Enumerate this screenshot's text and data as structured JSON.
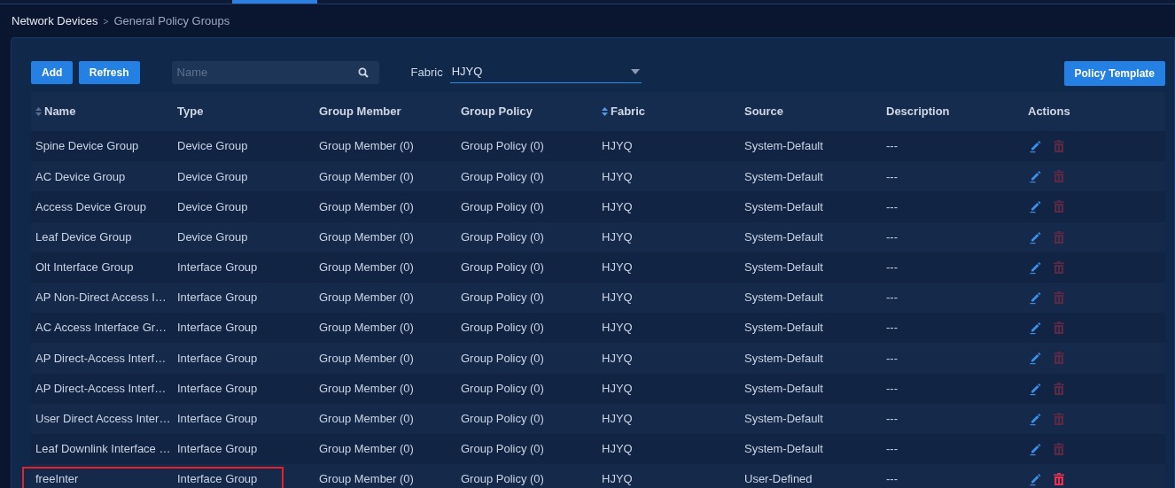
{
  "breadcrumb": [
    "Network Devices",
    ">",
    "General Policy Groups"
  ],
  "toolbar": {
    "buttons": [
      "Add",
      "Refresh"
    ],
    "search": {
      "placeholder": "Name"
    },
    "fabric_label": "Fabric",
    "fabric_value": "HJYQ",
    "template_button": "Policy Template"
  },
  "table": {
    "columns": [
      {
        "label": "Name",
        "sortable": true,
        "sorted": false
      },
      {
        "label": "Type",
        "sortable": false
      },
      {
        "label": "Group Member",
        "sortable": false
      },
      {
        "label": "Group Policy",
        "sortable": false
      },
      {
        "label": "Fabric",
        "sortable": true,
        "sorted": true
      },
      {
        "label": "Source",
        "sortable": false
      },
      {
        "label": "Description",
        "sortable": false
      },
      {
        "label": "Actions",
        "sortable": false
      }
    ],
    "rows": [
      {
        "cells": [
          "Spine Device Group",
          "Device Group",
          "Group Member (0)",
          "Group Policy (0)",
          "HJYQ",
          "System-Default",
          "---"
        ],
        "delete_disabled": true,
        "highlighted": false
      },
      {
        "cells": [
          "AC Device Group",
          "Device Group",
          "Group Member (0)",
          "Group Policy (0)",
          "HJYQ",
          "System-Default",
          "---"
        ],
        "delete_disabled": true,
        "highlighted": false
      },
      {
        "cells": [
          "Access Device Group",
          "Device Group",
          "Group Member (0)",
          "Group Policy (0)",
          "HJYQ",
          "System-Default",
          "---"
        ],
        "delete_disabled": true,
        "highlighted": false
      },
      {
        "cells": [
          "Leaf Device Group",
          "Device Group",
          "Group Member (0)",
          "Group Policy (0)",
          "HJYQ",
          "System-Default",
          "---"
        ],
        "delete_disabled": true,
        "highlighted": false
      },
      {
        "cells": [
          "Olt Interface Group",
          "Interface Group",
          "Group Member (0)",
          "Group Policy (0)",
          "HJYQ",
          "System-Default",
          "---"
        ],
        "delete_disabled": true,
        "highlighted": false
      },
      {
        "cells": [
          "AP Non-Direct Access I…",
          "Interface Group",
          "Group Member (0)",
          "Group Policy (0)",
          "HJYQ",
          "System-Default",
          "---"
        ],
        "delete_disabled": true,
        "highlighted": false
      },
      {
        "cells": [
          "AC Access Interface Gr…",
          "Interface Group",
          "Group Member (0)",
          "Group Policy (0)",
          "HJYQ",
          "System-Default",
          "---"
        ],
        "delete_disabled": true,
        "highlighted": false
      },
      {
        "cells": [
          "AP Direct-Access Interf…",
          "Interface Group",
          "Group Member (0)",
          "Group Policy (0)",
          "HJYQ",
          "System-Default",
          "---"
        ],
        "delete_disabled": true,
        "highlighted": false
      },
      {
        "cells": [
          "AP Direct-Access Interf…",
          "Interface Group",
          "Group Member (0)",
          "Group Policy (0)",
          "HJYQ",
          "System-Default",
          "---"
        ],
        "delete_disabled": true,
        "highlighted": false
      },
      {
        "cells": [
          "User Direct Access Inter…",
          "Interface Group",
          "Group Member (0)",
          "Group Policy (0)",
          "HJYQ",
          "System-Default",
          "---"
        ],
        "delete_disabled": true,
        "highlighted": false
      },
      {
        "cells": [
          "Leaf Downlink Interface …",
          "Interface Group",
          "Group Member (0)",
          "Group Policy (0)",
          "HJYQ",
          "System-Default",
          "---"
        ],
        "delete_disabled": true,
        "highlighted": false
      },
      {
        "cells": [
          "freeInter",
          "Interface Group",
          "Group Member (0)",
          "Group Policy (0)",
          "HJYQ",
          "User-Defined",
          "---"
        ],
        "delete_disabled": false,
        "highlighted": true
      }
    ]
  }
}
